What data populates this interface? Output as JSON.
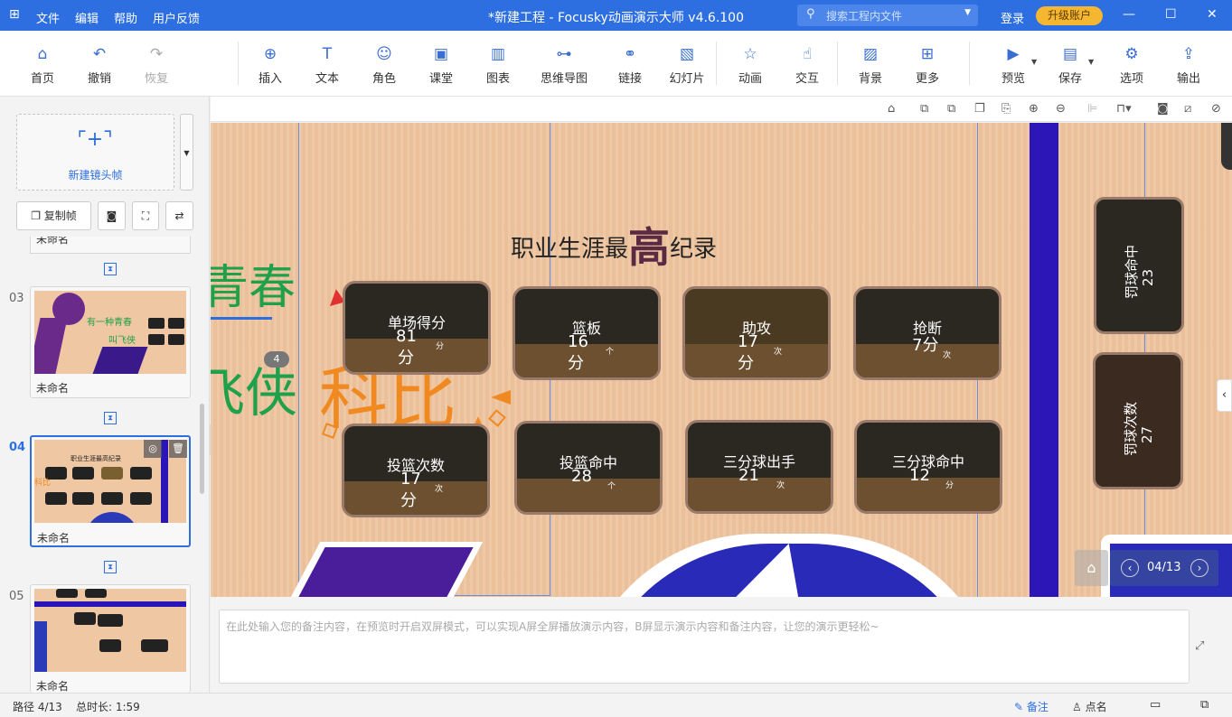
{
  "titlebar": {
    "logo": "⊞",
    "menus": [
      "文件",
      "编辑",
      "帮助",
      "用户反馈"
    ],
    "title": "*新建工程 - Focusky动画演示大师  v4.6.100",
    "search_placeholder": "搜索工程内文件",
    "login": "登录",
    "upgrade": "升级账户"
  },
  "toolbar": {
    "home": "首页",
    "undo": "撤销",
    "redo": "恢复",
    "insert": "插入",
    "text": "文本",
    "role": "角色",
    "classroom": "课堂",
    "chart": "图表",
    "mindmap": "思维导图",
    "link": "链接",
    "slides": "幻灯片",
    "animation": "动画",
    "interact": "交互",
    "background": "背景",
    "more": "更多",
    "preview": "预览",
    "save": "保存",
    "options": "选项",
    "export": "输出"
  },
  "sidebar": {
    "new_frame": "新建镜头帧",
    "copy_frame": "复制帧",
    "top_partial_name": "未命名",
    "slides": [
      {
        "num": "03",
        "name": "未命名",
        "thumb_text_1": "有一种青春",
        "thumb_text_2": "叫飞侠"
      },
      {
        "num": "04",
        "name": "未命名",
        "thumb_text_1": "职业生涯最高纪录"
      },
      {
        "num": "05",
        "name": "未命名"
      }
    ]
  },
  "stage": {
    "heading_pre": "职业生涯最",
    "heading_big": "高",
    "heading_post": "纪录",
    "green_1": "青春",
    "green_2": "飞侠",
    "orange": "科比",
    "badge": "4",
    "cards": [
      {
        "title": "单场得分",
        "value": "81",
        "unit_big": "分",
        "unit_small": "分"
      },
      {
        "title": "篮板",
        "value": "16",
        "unit_big": "分",
        "unit_small": "个"
      },
      {
        "title": "助攻",
        "value": "17",
        "unit_big": "分",
        "unit_small": "次"
      },
      {
        "title": "抢断",
        "value": "7分",
        "unit_small": "次"
      },
      {
        "title": "投篮次数",
        "value": "17",
        "unit_big": "分",
        "unit_small": "次"
      },
      {
        "title": "投篮命中",
        "value": "28",
        "unit_small": "个"
      },
      {
        "title": "三分球出手",
        "value": "21",
        "unit_small": "次"
      },
      {
        "title": "三分球命中",
        "value": "12",
        "unit_small": "分"
      }
    ],
    "vcards": [
      {
        "title": "罚球命中",
        "value": "23"
      },
      {
        "title": "罚球次数",
        "value": "27"
      }
    ],
    "page_indicator": "04/13"
  },
  "notes": {
    "placeholder": "在此处输入您的备注内容，在预览时开启双屏模式，可以实现A屏全屏播放演示内容，B屏显示演示内容和备注内容，让您的演示更轻松~"
  },
  "status": {
    "path": "路径 4/13",
    "duration": "总时长: 1:59",
    "notes_btn": "备注",
    "rollcall_btn": "点名"
  }
}
